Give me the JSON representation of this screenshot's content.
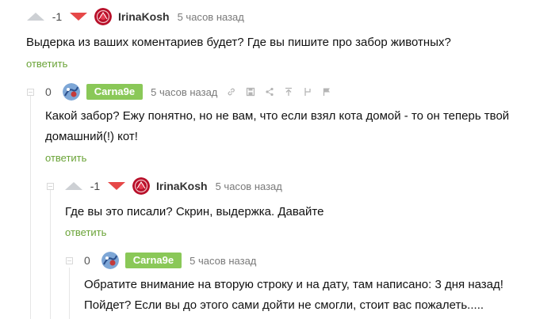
{
  "comments": [
    {
      "rating": "-1",
      "username": "IrinaKosh",
      "time": "5 часов назад",
      "text": "Выдерка из ваших коментариев будет? Где вы пишите про забор животных?",
      "reply": "ответить"
    },
    {
      "rating": "0",
      "username": "Carna9e",
      "time": "5 часов назад",
      "text_line1": "Какой забор? Ежу понятно, но не вам, что если взял кота домой - то он теперь твой",
      "text_line2": "домашний(!) кот!",
      "reply": "ответить"
    },
    {
      "rating": "-1",
      "username": "IrinaKosh",
      "time": "5 часов назад",
      "text": "Где вы это писали? Скрин, выдержка. Давайте",
      "reply": "ответить"
    },
    {
      "rating": "0",
      "username": "Carna9e",
      "time": "5 часов назад",
      "text_line1": "Обратите внимание на вторую строку и на дату, там написано: 3 дня назад!",
      "text_line2": "Пойдет? Если вы до этого сами дойти не смогли, стоит вас пожалеть....."
    }
  ],
  "icons": {
    "tools": [
      "link-icon",
      "save-icon",
      "share-icon",
      "scroll-up-icon",
      "branch-icon",
      "report-flag-icon"
    ]
  },
  "colors": {
    "downvote": "#e64848",
    "upvote": "#cdd0d4",
    "badge": "#8ac858",
    "reply_link": "#6aa337"
  }
}
